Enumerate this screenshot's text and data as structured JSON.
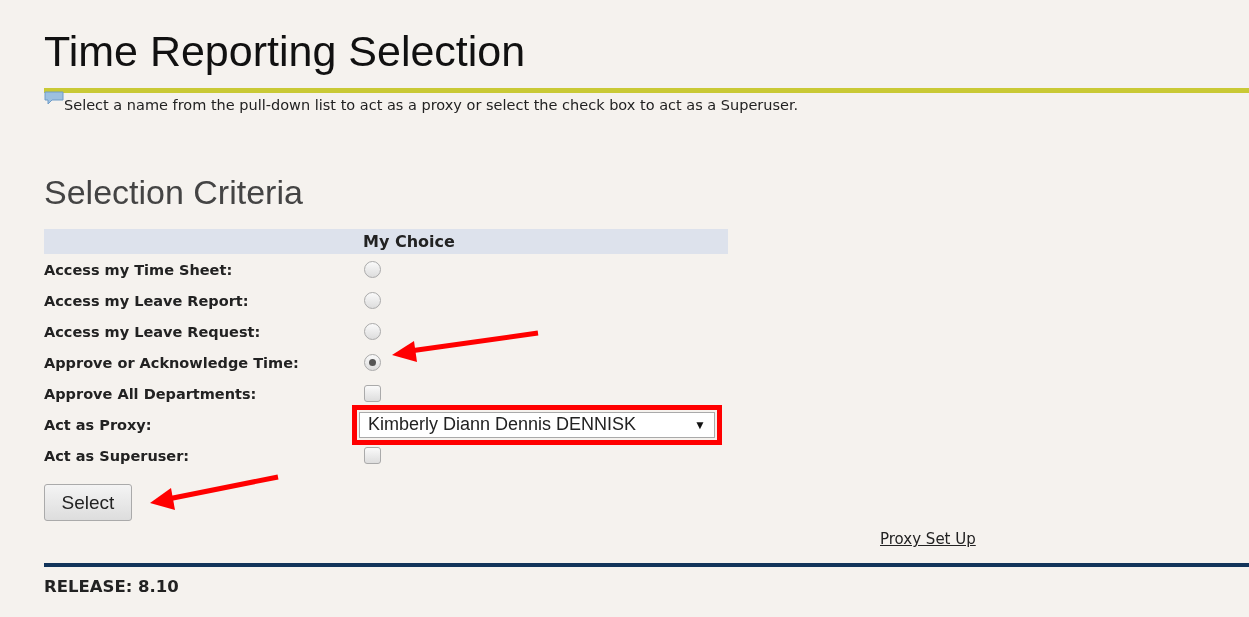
{
  "title": "Time Reporting Selection",
  "info": "Select a name from the pull-down list to act as a proxy or select the check box to act as a Superuser.",
  "section_title": "Selection Criteria",
  "table": {
    "header": "My Choice",
    "rows": [
      {
        "label": "Access my Time Sheet:",
        "kind": "radio",
        "selected": false
      },
      {
        "label": "Access my Leave Report:",
        "kind": "radio",
        "selected": false
      },
      {
        "label": "Access my Leave Request:",
        "kind": "radio",
        "selected": false
      },
      {
        "label": "Approve or Acknowledge Time:",
        "kind": "radio",
        "selected": true
      },
      {
        "label": "Approve All Departments:",
        "kind": "checkbox",
        "checked": false
      },
      {
        "label": "Act as Proxy:",
        "kind": "select",
        "value": "Kimberly Diann Dennis DENNISK",
        "arrow": "▼"
      },
      {
        "label": "Act as Superuser:",
        "kind": "checkbox",
        "checked": false
      }
    ]
  },
  "select_button": "Select",
  "proxy_link": "Proxy Set Up",
  "release": "RELEASE: 8.10"
}
